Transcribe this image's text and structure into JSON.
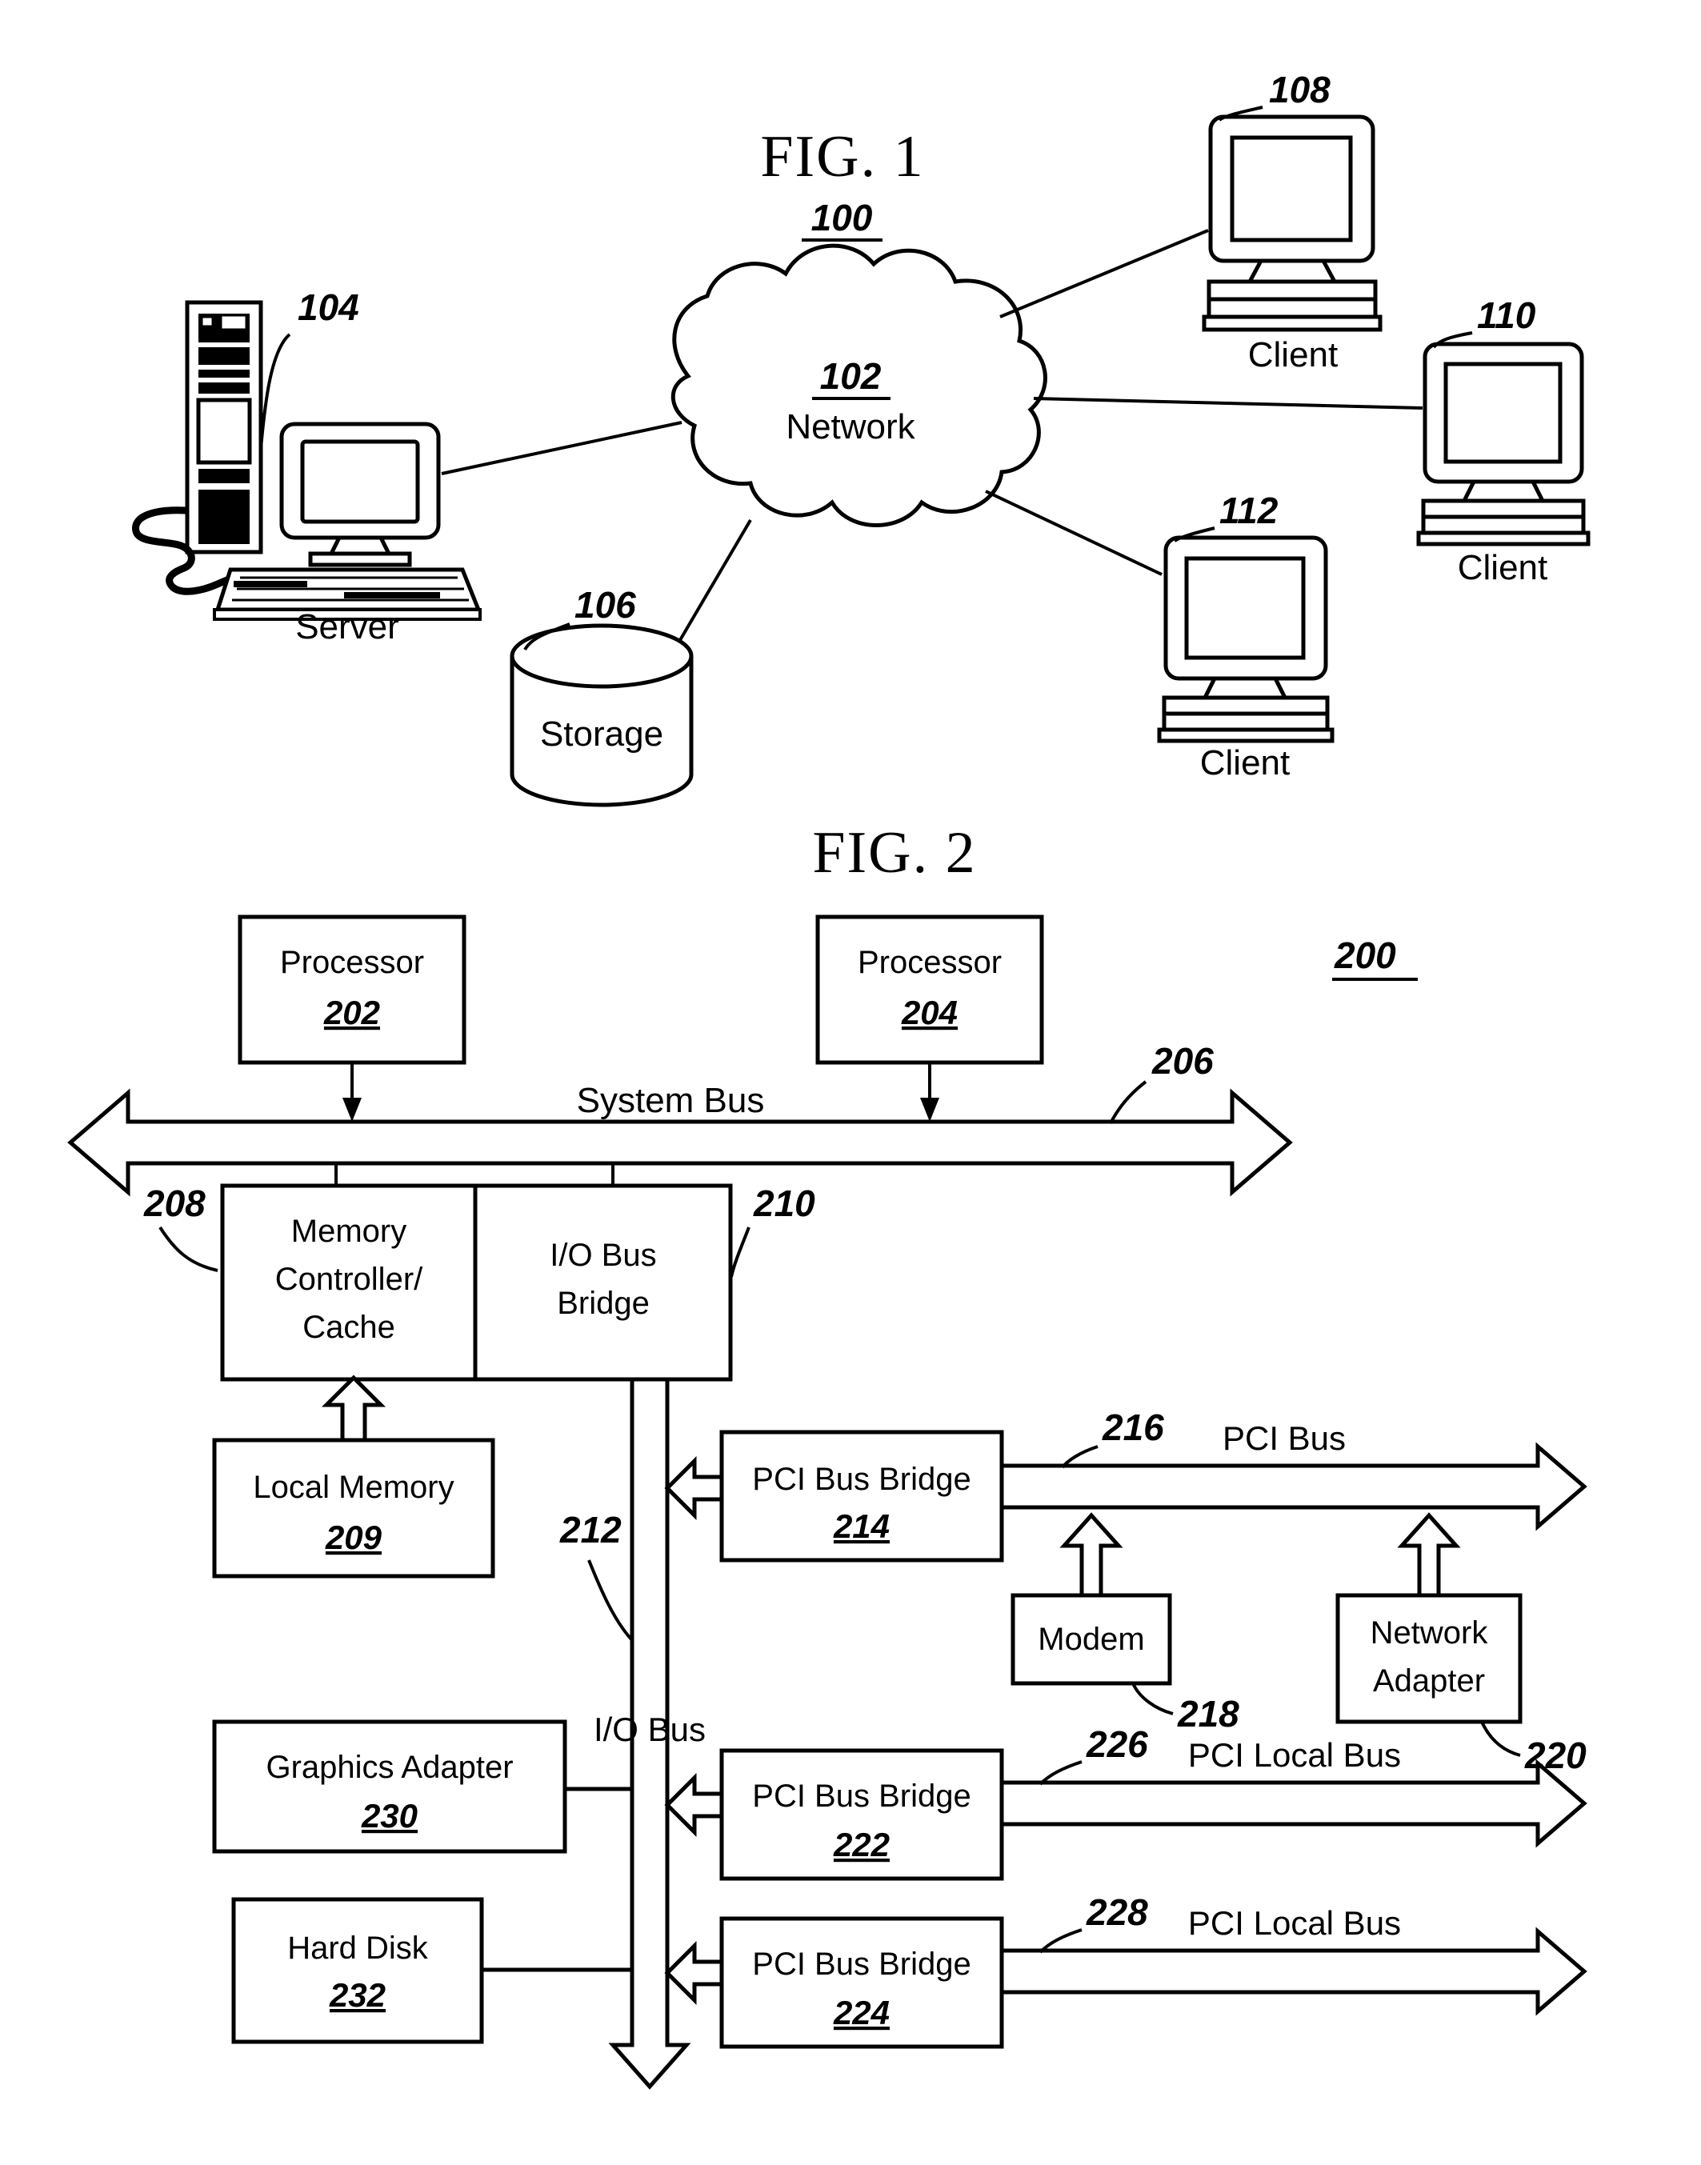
{
  "figure1": {
    "title": "FIG. 1",
    "ref": "100",
    "network": {
      "ref": "102",
      "label": "Network"
    },
    "server": {
      "ref": "104",
      "label": "Server"
    },
    "storage": {
      "ref": "106",
      "label": "Storage"
    },
    "clients": [
      {
        "ref": "108",
        "label": "Client"
      },
      {
        "ref": "110",
        "label": "Client"
      },
      {
        "ref": "112",
        "label": "Client"
      }
    ]
  },
  "figure2": {
    "title": "FIG. 2",
    "ref": "200",
    "processors": [
      {
        "label": "Processor",
        "ref": "202"
      },
      {
        "label": "Processor",
        "ref": "204"
      }
    ],
    "system_bus": {
      "label": "System Bus",
      "ref": "206"
    },
    "memory_controller": {
      "line1": "Memory",
      "line2": "Controller/",
      "line3": "Cache",
      "ref": "208"
    },
    "io_bus_bridge": {
      "line1": "I/O Bus",
      "line2": "Bridge",
      "ref": "210"
    },
    "local_memory": {
      "label": "Local Memory",
      "ref": "209"
    },
    "io_bus": {
      "label": "I/O Bus",
      "ref": "212"
    },
    "pci_bridge_top": {
      "label": "PCI Bus Bridge",
      "ref": "214"
    },
    "pci_bus_top": {
      "label": "PCI Bus",
      "ref": "216"
    },
    "modem": {
      "label": "Modem",
      "ref": "218"
    },
    "network_adapter": {
      "line1": "Network",
      "line2": "Adapter",
      "ref": "220"
    },
    "pci_bridge_mid": {
      "label": "PCI Bus Bridge",
      "ref": "222"
    },
    "pci_local_bus_mid": {
      "label": "PCI Local Bus",
      "ref": "226"
    },
    "pci_bridge_bottom": {
      "label": "PCI Bus Bridge",
      "ref": "224"
    },
    "pci_local_bus_bottom": {
      "label": "PCI Local Bus",
      "ref": "228"
    },
    "graphics_adapter": {
      "label": "Graphics Adapter",
      "ref": "230"
    },
    "hard_disk": {
      "label": "Hard Disk",
      "ref": "232"
    }
  },
  "colors": {
    "ink": "#000000",
    "paper": "#ffffff"
  }
}
